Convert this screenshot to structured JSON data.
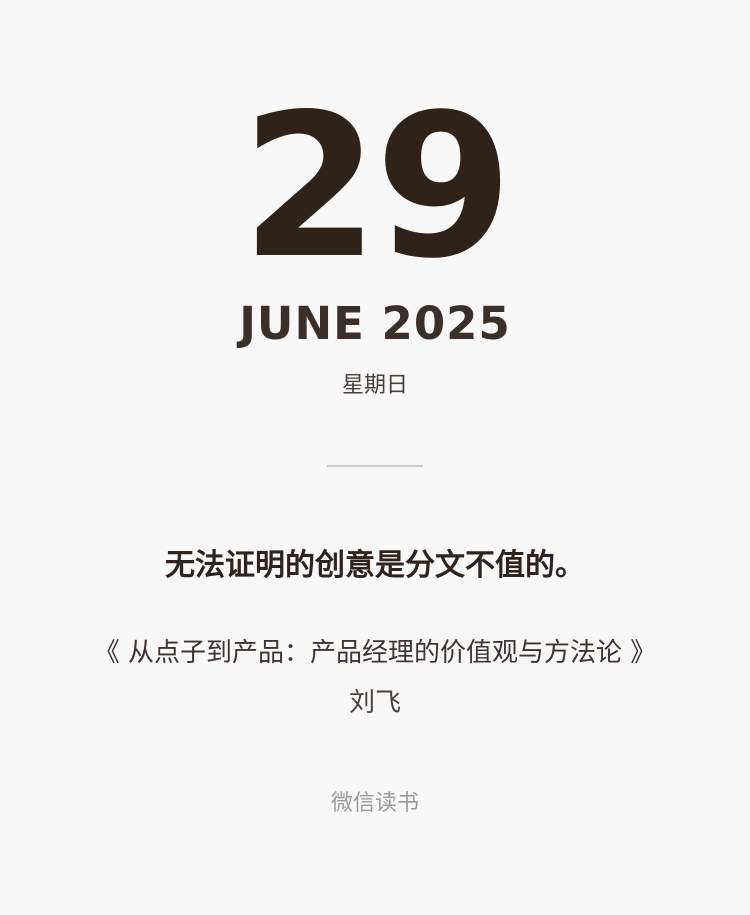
{
  "calendar": {
    "day": "29",
    "month_year": "JUNE 2025",
    "weekday": "星期日"
  },
  "quote": {
    "text": "无法证明的创意是分文不值的。",
    "book_title": "《 从点子到产品：产品经理的价值观与方法论 》",
    "author": "刘飞"
  },
  "footer": {
    "app_name": "微信读书"
  }
}
